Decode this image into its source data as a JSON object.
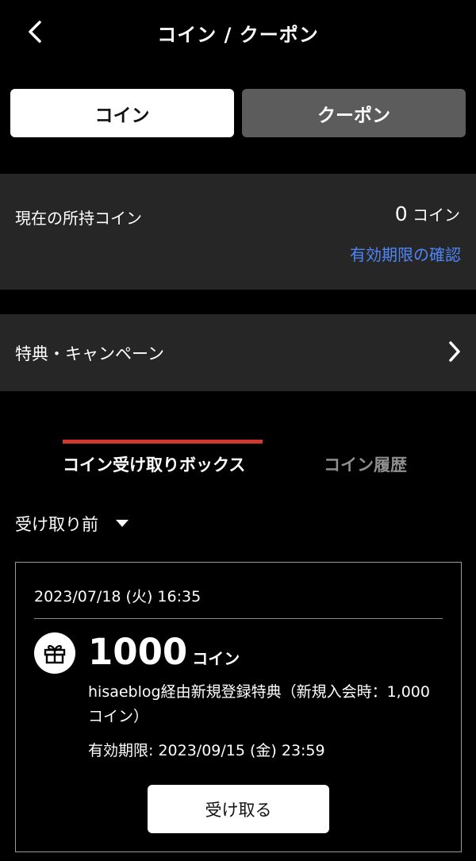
{
  "header": {
    "title": "コイン / クーポン"
  },
  "segments": {
    "coin": "コイン",
    "coupon": "クーポン"
  },
  "coins": {
    "label": "現在の所持コイン",
    "amount": "0",
    "unit": "コイン",
    "expiry_link": "有効期限の確認"
  },
  "campaign": {
    "label": "特典・キャンペーン"
  },
  "tabs": {
    "box": "コイン受け取りボックス",
    "history": "コイン履歴"
  },
  "filter": {
    "selected": "受け取り前"
  },
  "card": {
    "date": "2023/07/18 (火) 16:35",
    "amount": "1000",
    "unit": "コイン",
    "description": "hisaeblog経由新規登録特典（新規入会時：1,000コイン）",
    "expiry": "有効期限:  2023/09/15 (金) 23:59",
    "button": "受け取る"
  },
  "colors": {
    "accent_link": "#4f86f7",
    "tab_indicator": "#d0392b"
  },
  "icons": {
    "back": "chevron-left-icon",
    "campaign": "chevron-right-icon",
    "filter": "caret-down-icon",
    "gift": "gift-icon"
  }
}
